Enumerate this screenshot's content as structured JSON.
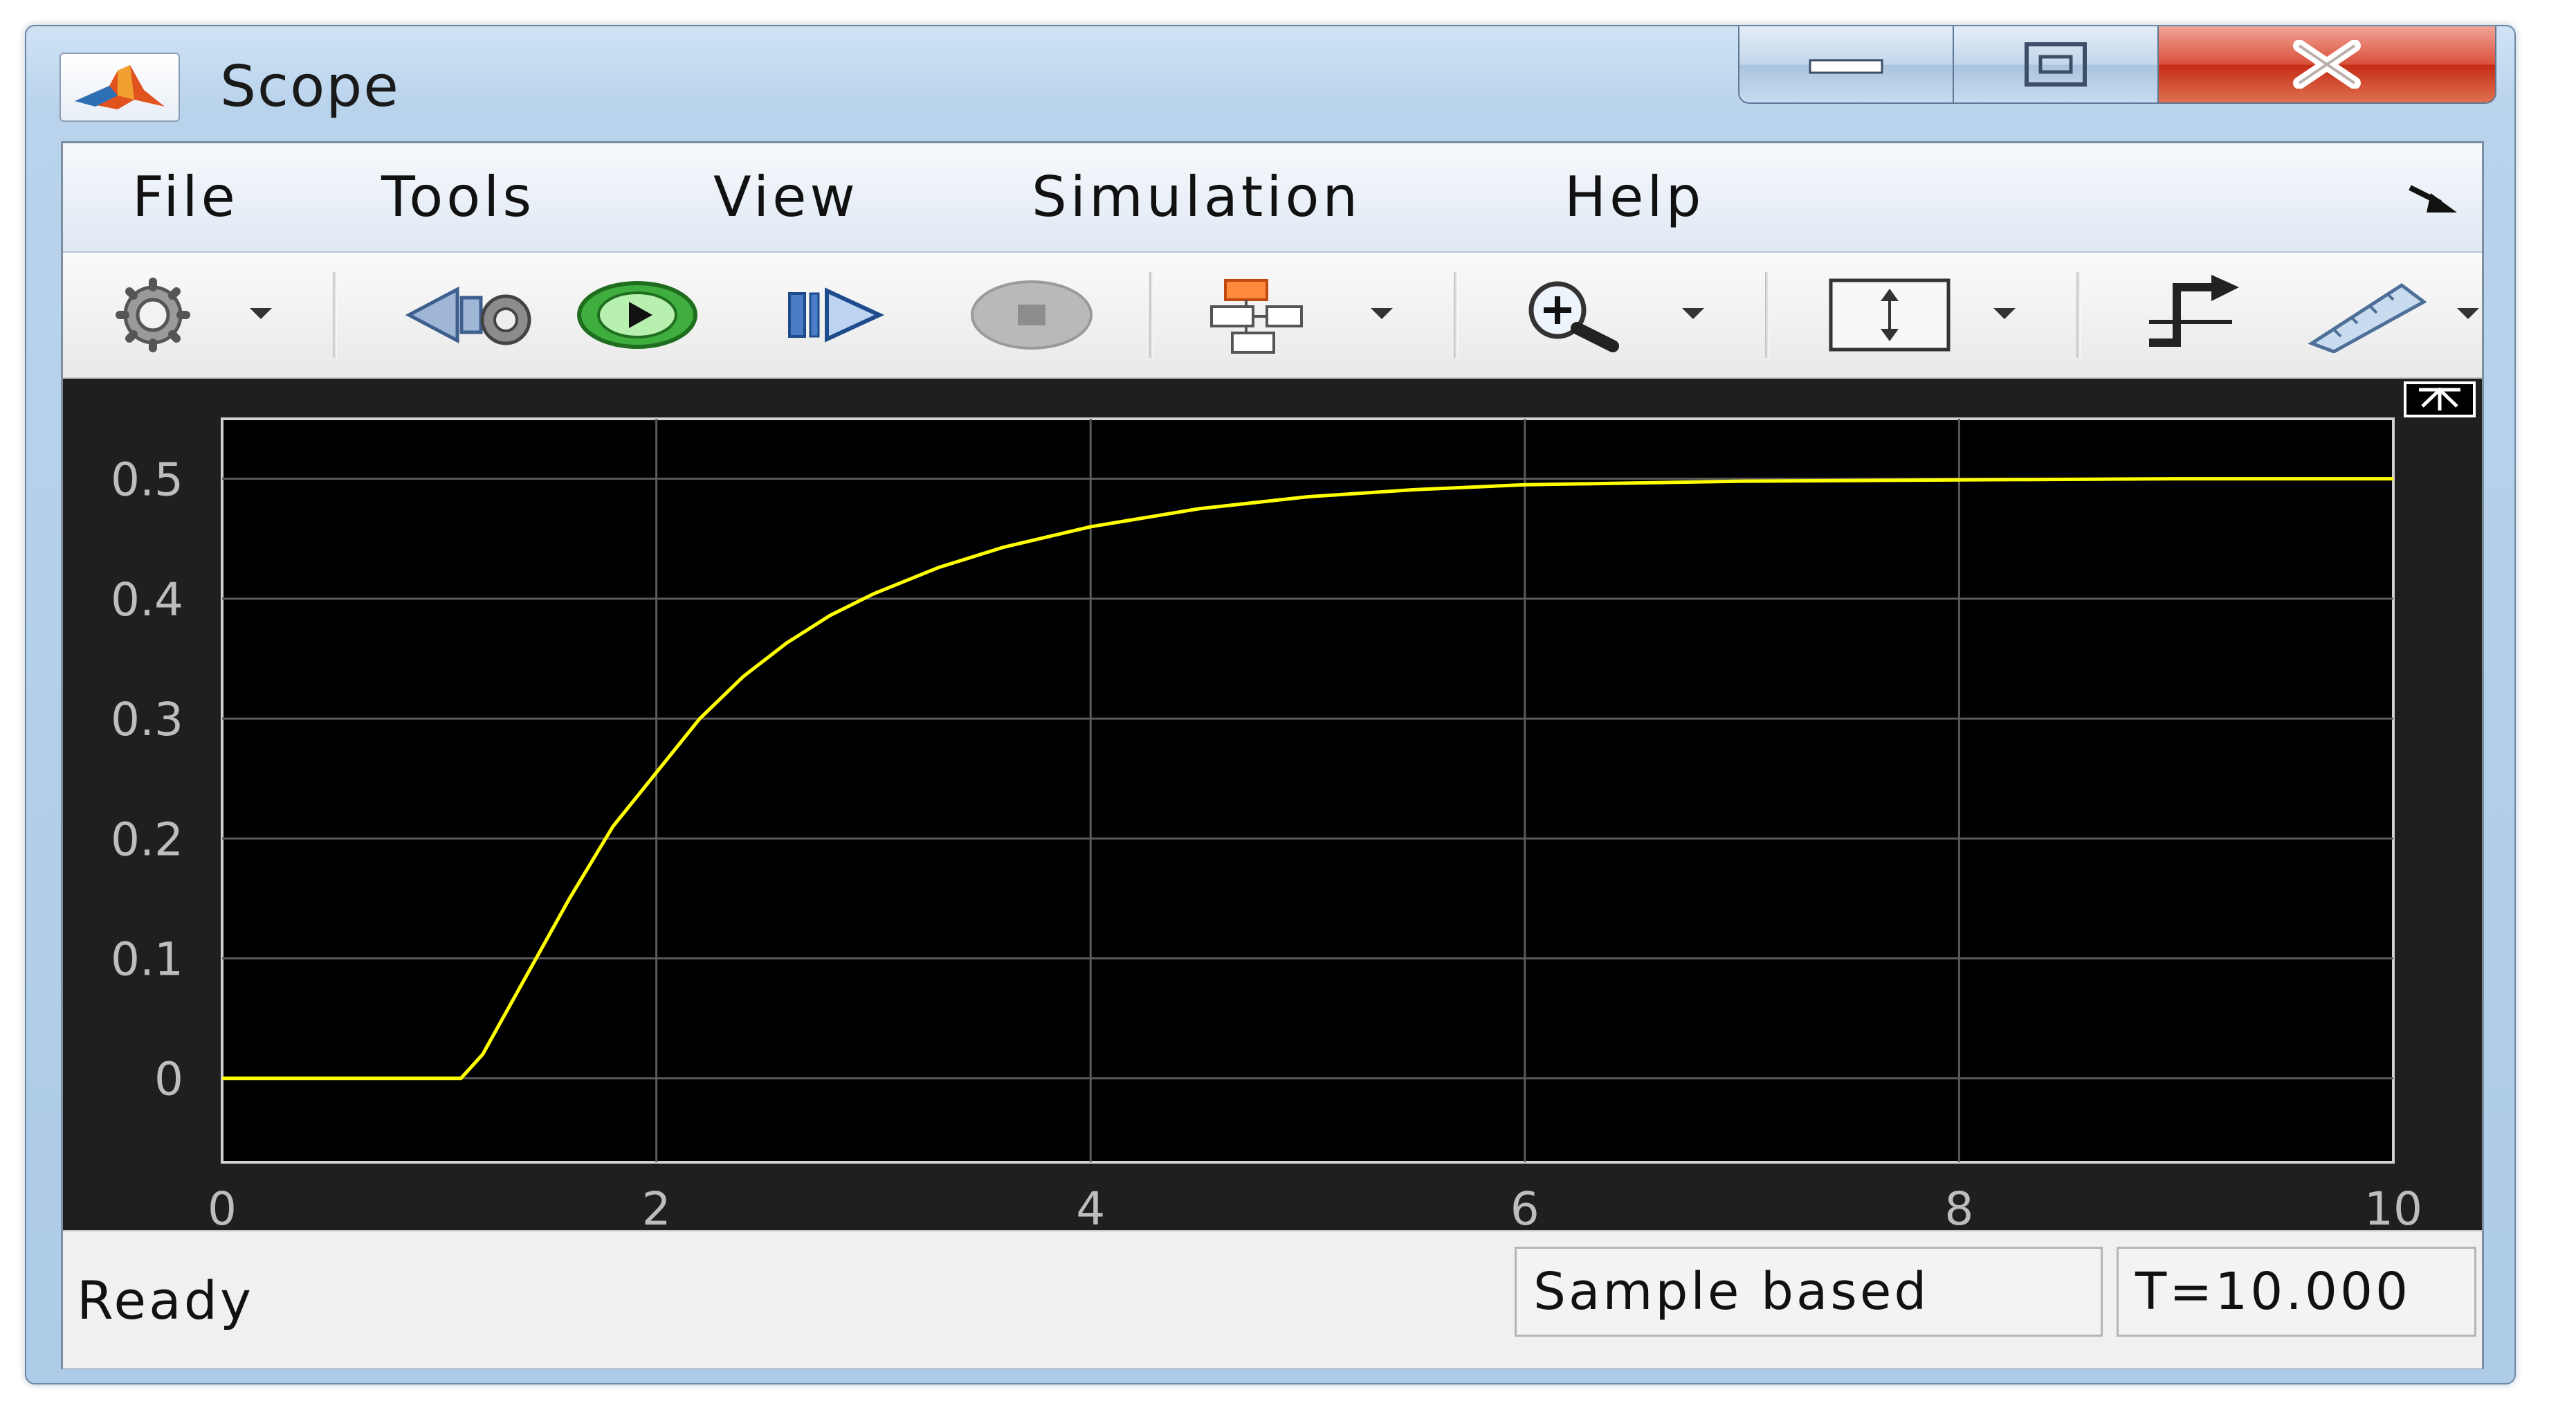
{
  "window": {
    "title": "Scope",
    "controls": {
      "minimize_icon": "minimize-icon",
      "maximize_icon": "maximize-icon",
      "close_icon": "close-icon"
    }
  },
  "menu": {
    "items": [
      "File",
      "Tools",
      "View",
      "Simulation",
      "Help"
    ],
    "dock_icon": "undock-arrow-icon"
  },
  "toolbar": {
    "buttons": [
      {
        "icon": "gear-icon",
        "has_dropdown": true
      },
      {
        "icon": "step-back-icon",
        "has_dropdown": false
      },
      {
        "icon": "run-icon",
        "has_dropdown": false
      },
      {
        "icon": "step-forward-icon",
        "has_dropdown": false
      },
      {
        "icon": "stop-icon",
        "has_dropdown": false
      },
      {
        "icon": "highlight-block-icon",
        "has_dropdown": true
      },
      {
        "icon": "zoom-in-icon",
        "has_dropdown": true
      },
      {
        "icon": "autoscale-icon",
        "has_dropdown": true
      },
      {
        "icon": "triggers-icon",
        "has_dropdown": false
      },
      {
        "icon": "measurements-ruler-icon",
        "has_dropdown": true
      }
    ]
  },
  "chart_data": {
    "type": "line",
    "title": "",
    "xlabel": "",
    "ylabel": "",
    "xlim": [
      0,
      10
    ],
    "ylim": [
      -0.07,
      0.55
    ],
    "x_ticks": [
      "0",
      "2",
      "4",
      "6",
      "8",
      "10"
    ],
    "y_ticks": [
      "0",
      "0.1",
      "0.2",
      "0.3",
      "0.4",
      "0.5"
    ],
    "grid": true,
    "background": "#000000",
    "series": [
      {
        "color": "#ffff00",
        "x": [
          0,
          1,
          1.1,
          1.2,
          1.4,
          1.6,
          1.8,
          2.0,
          2.2,
          2.4,
          2.6,
          2.8,
          3.0,
          3.3,
          3.6,
          4.0,
          4.5,
          5.0,
          5.5,
          6.0,
          7.0,
          8.0,
          9.0,
          10.0
        ],
        "y": [
          0,
          0,
          0,
          0.02,
          0.085,
          0.15,
          0.21,
          0.255,
          0.3,
          0.335,
          0.363,
          0.386,
          0.404,
          0.426,
          0.443,
          0.46,
          0.475,
          0.485,
          0.491,
          0.495,
          0.498,
          0.499,
          0.5,
          0.5
        ]
      }
    ]
  },
  "status": {
    "left": "Ready",
    "mode": "Sample based",
    "time": "T=10.000"
  }
}
